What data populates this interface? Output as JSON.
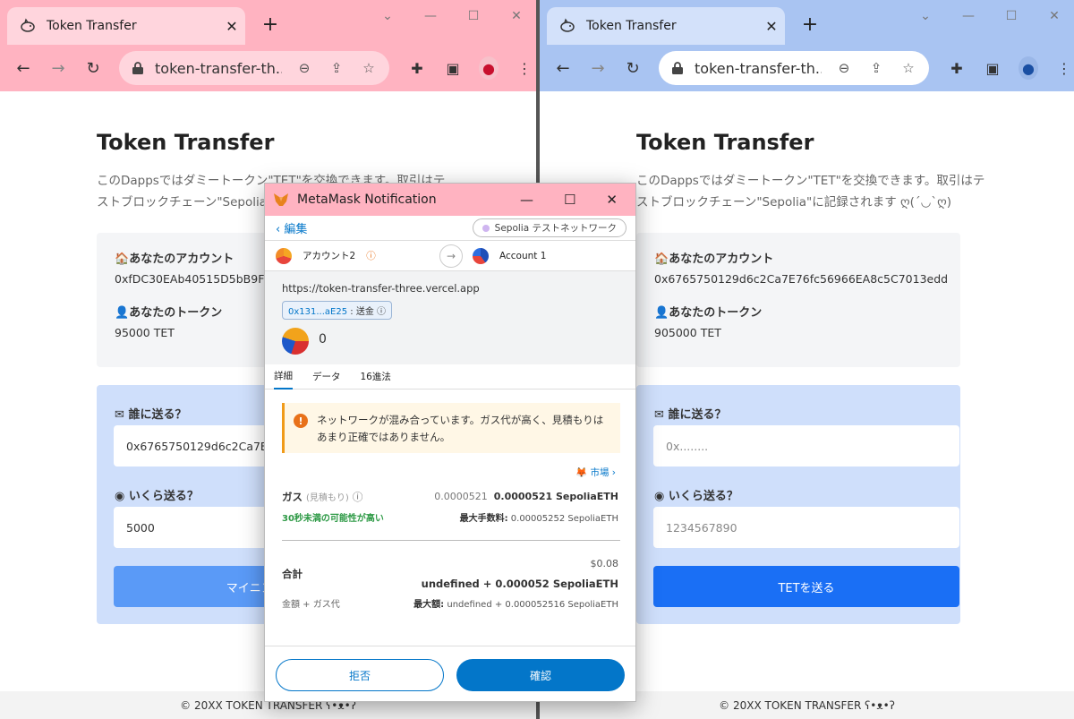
{
  "left_window": {
    "tab_title": "Token Transfer",
    "url": "token-transfer-th...",
    "page": {
      "title": "Token Transfer",
      "intro": "このDappsではダミートークン\"TET\"を交換できます。取引はテストブロックチェーン\"Sepolia\"に記録されます",
      "account_label": "あなたのアカウント",
      "account_value": "0xfDC30EAb40515D5bB9F9CD",
      "token_label": "あなたのトークン",
      "token_value": "95000 TET",
      "to_label": "誰に送る？",
      "to_value": "0x6765750129d6c2Ca7E76f",
      "amount_label": "いくら送る？",
      "amount_value": "5000",
      "button": "マイニング中..."
    },
    "footer": "© 20XX TOKEN TRANSFER ʕ•ᴥ•ʔ"
  },
  "right_window": {
    "tab_title": "Token Transfer",
    "url": "token-transfer-th...",
    "page": {
      "title": "Token Transfer",
      "intro": "このDappsではダミートークン\"TET\"を交換できます。取引はテストブロックチェーン\"Sepolia\"に記録されます ღ(ˊ◡ˋღ)",
      "account_label": "あなたのアカウント",
      "account_value": "0x6765750129d6c2Ca7E76fc56966EA8c5C7013edd",
      "token_label": "あなたのトークン",
      "token_value": "905000 TET",
      "to_label": "誰に送る？",
      "to_placeholder": "0x........",
      "amount_label": "いくら送る？",
      "amount_placeholder": "1234567890",
      "button": "TETを送る"
    },
    "footer": "© 20XX TOKEN TRANSFER ʕ•ᴥ•ʔ"
  },
  "metamask": {
    "window_title": "MetaMask Notification",
    "edit": "編集",
    "network": "Sepolia テストネットワーク",
    "from_account": "アカウント2",
    "to_account": "Account 1",
    "origin": "https://token-transfer-three.vercel.app",
    "method_addr": "0x131...aE25",
    "method_name": ": 送金",
    "amount": "0",
    "tabs": [
      "詳細",
      "データ",
      "16進法"
    ],
    "warning": "ネットワークが混み合っています。ガス代が高く、見積もりはあまり正確ではありません。",
    "market": "市場",
    "gas_label": "ガス",
    "gas_sub": "(見積もり)",
    "gas_value_dim": "0.0000521",
    "gas_value": "0.0000521 SepoliaETH",
    "gas_time": "30秒未満の可能性が高い",
    "max_fee_label": "最大手数料:",
    "max_fee_value": "0.00005252 SepoliaETH",
    "total_label": "合計",
    "total_usd": "$0.08",
    "total_value": "undefined + 0.000052 SepoliaETH",
    "total_sub": "金額 + ガス代",
    "max_amount_label": "最大額:",
    "max_amount_value": "undefined + 0.000052516 SepoliaETH",
    "reject": "拒否",
    "confirm": "確認"
  },
  "colors": {
    "left_chrome": "#ffb3c1",
    "right_chrome": "#a9c4f2",
    "metamask_blue": "#0376c9",
    "send_button": "#1a6ff5",
    "mining_button": "#5a9af7",
    "warning_accent": "#f09b1a",
    "success_green": "#2e9a46"
  }
}
